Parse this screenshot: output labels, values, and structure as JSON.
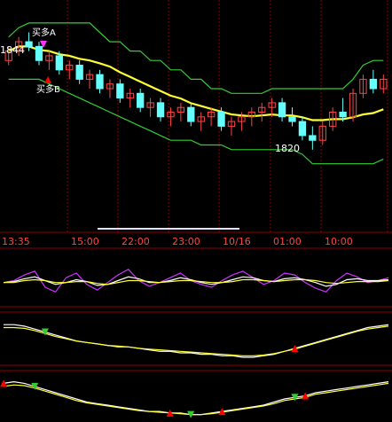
{
  "chart_data": [
    {
      "panel": "main-price",
      "type": "candlestick",
      "title": "",
      "x": [
        "13:35",
        "15:00",
        "22:00",
        "23:00",
        "10/16",
        "01:00",
        "10:00"
      ],
      "price_labels": {
        "high": "1844",
        "low": "1820"
      },
      "markers": [
        {
          "label": "买多A",
          "marker": "down-arrow",
          "color": "#ff33ff"
        },
        {
          "label": "买多B",
          "marker": "up-arrow",
          "color": "#ff0000"
        }
      ],
      "series": [
        {
          "color": "#ffff33",
          "kind": "line"
        },
        {
          "color": "#33cc33",
          "kind": "channel-upper"
        },
        {
          "color": "#33cc33",
          "kind": "channel-lower"
        }
      ],
      "candles": [
        [
          1839,
          1842,
          1838,
          1841
        ],
        [
          1841,
          1844,
          1840,
          1843
        ],
        [
          1843,
          1845,
          1841,
          1842
        ],
        [
          1842,
          1843,
          1838,
          1839
        ],
        [
          1839,
          1841,
          1837,
          1840
        ],
        [
          1840,
          1841,
          1836,
          1837
        ],
        [
          1837,
          1839,
          1835,
          1838
        ],
        [
          1838,
          1839,
          1834,
          1835
        ],
        [
          1835,
          1837,
          1833,
          1836
        ],
        [
          1836,
          1837,
          1832,
          1833
        ],
        [
          1833,
          1835,
          1831,
          1834
        ],
        [
          1834,
          1835,
          1830,
          1831
        ],
        [
          1831,
          1833,
          1829,
          1832
        ],
        [
          1832,
          1833,
          1828,
          1829
        ],
        [
          1829,
          1831,
          1827,
          1830
        ],
        [
          1830,
          1831,
          1826,
          1827
        ],
        [
          1827,
          1829,
          1825,
          1828
        ],
        [
          1828,
          1830,
          1826,
          1829
        ],
        [
          1829,
          1830,
          1825,
          1826
        ],
        [
          1826,
          1828,
          1824,
          1827
        ],
        [
          1827,
          1829,
          1825,
          1828
        ],
        [
          1828,
          1829,
          1824,
          1825
        ],
        [
          1825,
          1827,
          1823,
          1826
        ],
        [
          1826,
          1828,
          1824,
          1827
        ],
        [
          1827,
          1829,
          1825,
          1828
        ],
        [
          1828,
          1830,
          1826,
          1829
        ],
        [
          1829,
          1831,
          1827,
          1830
        ],
        [
          1830,
          1831,
          1826,
          1827
        ],
        [
          1827,
          1829,
          1825,
          1826
        ],
        [
          1826,
          1827,
          1822,
          1823
        ],
        [
          1823,
          1825,
          1820,
          1822
        ],
        [
          1822,
          1826,
          1821,
          1825
        ],
        [
          1825,
          1829,
          1824,
          1828
        ],
        [
          1828,
          1831,
          1826,
          1827
        ],
        [
          1827,
          1833,
          1826,
          1832
        ],
        [
          1832,
          1836,
          1831,
          1835
        ],
        [
          1835,
          1837,
          1832,
          1833
        ],
        [
          1833,
          1836,
          1832,
          1835
        ]
      ]
    },
    {
      "panel": "time-axis",
      "labels": [
        "13:35",
        "15:00",
        "22:00",
        "23:00",
        "10/16",
        "01:00",
        "10:00"
      ]
    },
    {
      "panel": "oscillator-1",
      "type": "line",
      "series": [
        {
          "color": "#cc33ff",
          "values": [
            50,
            52,
            58,
            62,
            45,
            40,
            55,
            60,
            48,
            42,
            50,
            58,
            64,
            52,
            46,
            50,
            55,
            60,
            52,
            48,
            45,
            52,
            58,
            62,
            55,
            48,
            52,
            60,
            58,
            50,
            44,
            40,
            52,
            60,
            56,
            50,
            52,
            55
          ]
        },
        {
          "color": "#ffffff",
          "values": [
            50,
            51,
            54,
            56,
            52,
            48,
            50,
            53,
            51,
            47,
            48,
            52,
            56,
            54,
            50,
            50,
            52,
            55,
            53,
            50,
            48,
            50,
            53,
            56,
            55,
            52,
            51,
            54,
            55,
            53,
            50,
            46,
            48,
            53,
            54,
            52,
            52,
            53
          ]
        },
        {
          "color": "#ffff33",
          "values": [
            50,
            50,
            52,
            53,
            52,
            50,
            50,
            51,
            51,
            49,
            48,
            50,
            52,
            52,
            51,
            50,
            51,
            52,
            52,
            51,
            50,
            50,
            51,
            53,
            53,
            52,
            51,
            52,
            53,
            53,
            52,
            50,
            49,
            50,
            51,
            51,
            51,
            52
          ]
        }
      ]
    },
    {
      "panel": "step-indicator-1",
      "type": "line",
      "series": [
        {
          "color": "#ffffff",
          "values": [
            80,
            80,
            78,
            74,
            70,
            66,
            62,
            58,
            56,
            54,
            52,
            50,
            50,
            48,
            46,
            44,
            44,
            42,
            42,
            40,
            40,
            38,
            38,
            36,
            36,
            38,
            40,
            44,
            48,
            52,
            56,
            60,
            64,
            68,
            72,
            76,
            78,
            80
          ]
        },
        {
          "color": "#ffff33",
          "values": [
            76,
            76,
            75,
            72,
            68,
            64,
            61,
            58,
            56,
            54,
            52,
            51,
            50,
            48,
            47,
            46,
            45,
            44,
            43,
            42,
            41,
            40,
            39,
            38,
            38,
            39,
            41,
            44,
            47,
            51,
            55,
            59,
            63,
            67,
            71,
            74,
            76,
            78
          ]
        }
      ],
      "signals": [
        {
          "index": 4,
          "marker": "down-arrow",
          "color": "#33cc33"
        },
        {
          "index": 28,
          "marker": "up-arrow",
          "color": "#ff0000"
        }
      ]
    },
    {
      "panel": "step-indicator-2",
      "type": "line",
      "series": [
        {
          "color": "#ffffff",
          "values": [
            80,
            82,
            80,
            76,
            72,
            68,
            64,
            60,
            56,
            54,
            52,
            50,
            48,
            46,
            44,
            44,
            42,
            42,
            40,
            40,
            42,
            44,
            46,
            48,
            50,
            52,
            56,
            60,
            62,
            64,
            68,
            70,
            72,
            74,
            76,
            78,
            80,
            82
          ]
        },
        {
          "color": "#ffff33",
          "values": [
            76,
            78,
            77,
            74,
            70,
            66,
            62,
            58,
            55,
            53,
            51,
            49,
            47,
            45,
            44,
            43,
            42,
            41,
            40,
            40,
            41,
            43,
            45,
            47,
            49,
            51,
            54,
            58,
            60,
            62,
            66,
            68,
            70,
            72,
            74,
            76,
            78,
            80
          ]
        }
      ],
      "signals": [
        {
          "index": 0,
          "marker": "up-arrow",
          "color": "#ff0000"
        },
        {
          "index": 3,
          "marker": "down-arrow",
          "color": "#33cc33"
        },
        {
          "index": 16,
          "marker": "up-arrow",
          "color": "#ff0000"
        },
        {
          "index": 18,
          "marker": "down-arrow",
          "color": "#33cc33"
        },
        {
          "index": 21,
          "marker": "up-arrow",
          "color": "#ff0000"
        },
        {
          "index": 28,
          "marker": "down-arrow",
          "color": "#33cc33"
        },
        {
          "index": 29,
          "marker": "up-arrow",
          "color": "#ff0000"
        }
      ]
    }
  ],
  "colors": {
    "background": "#000000",
    "grid": "#8b0000",
    "axis_text": "#ff4444",
    "up_candle": "#ff4444",
    "down_candle": "#66ffff",
    "ma": "#ffff33",
    "channel": "#33cc33"
  }
}
